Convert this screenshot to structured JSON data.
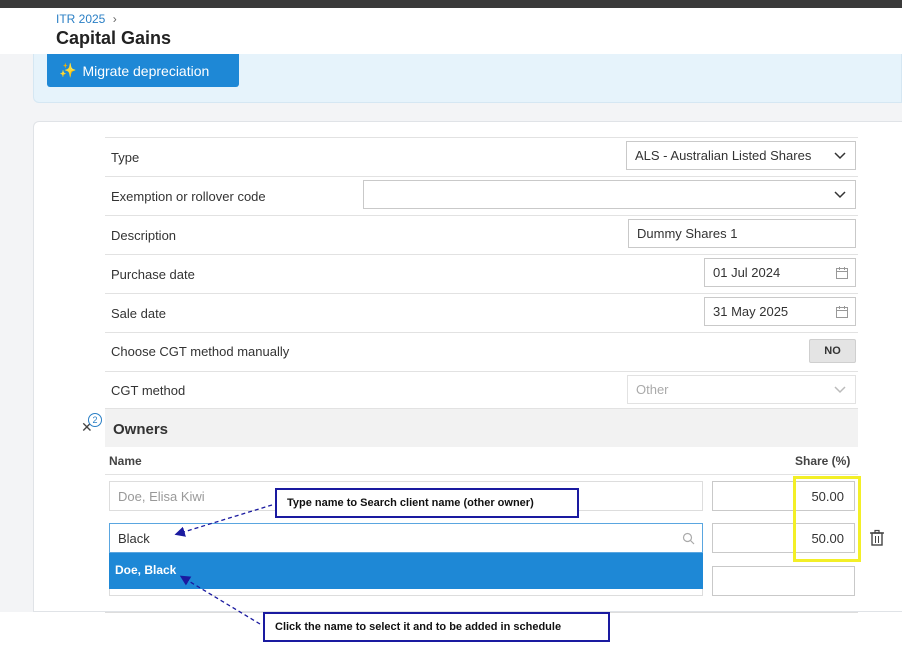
{
  "breadcrumb": {
    "parent": "ITR 2025",
    "separator": "›"
  },
  "page": {
    "title": "Capital Gains"
  },
  "banner": {
    "migrate_label": "Migrate depreciation",
    "migrate_icon": "sparkle-icon"
  },
  "form": {
    "type": {
      "label": "Type",
      "value": "ALS - Australian Listed Shares"
    },
    "exemption": {
      "label": "Exemption or rollover code",
      "value": ""
    },
    "description": {
      "label": "Description",
      "value": "Dummy Shares 1"
    },
    "purchase_date": {
      "label": "Purchase date",
      "value": "01 Jul 2024"
    },
    "sale_date": {
      "label": "Sale date",
      "value": "31 May 2025"
    },
    "cgt_manual": {
      "label": "Choose CGT method manually",
      "toggle": "NO"
    },
    "cgt_method": {
      "label": "CGT method",
      "value": "Other"
    }
  },
  "owners": {
    "title": "Owners",
    "badge_count": "2",
    "col_name": "Name",
    "col_share": "Share (%)",
    "rows": [
      {
        "name": "Doe, Elisa Kiwi",
        "share": "50.00"
      },
      {
        "name": "Black",
        "share": "50.00"
      },
      {
        "name": "",
        "share": ""
      }
    ],
    "suggestion": "Doe, Black"
  },
  "annotations": {
    "search_note": "Type name to Search client name (other owner)",
    "select_note": "Click the name to select it and to be added in schedule"
  },
  "colors": {
    "accent": "#1e88d6",
    "highlight": "#f3ef27",
    "note_border": "#1a1aa0"
  }
}
